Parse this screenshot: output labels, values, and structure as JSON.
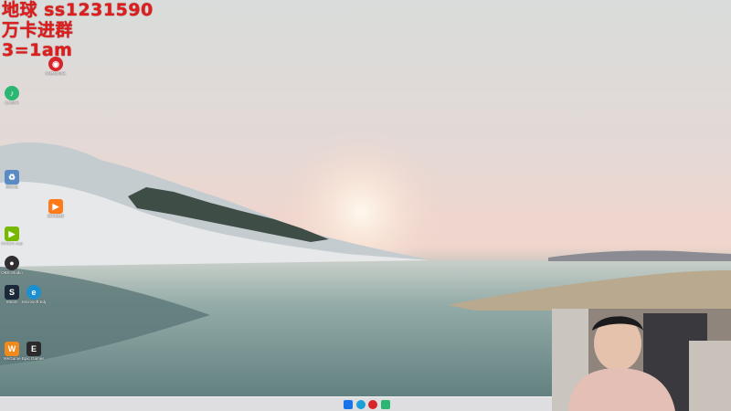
{
  "overlay": {
    "line1": "地球 ss1231590",
    "line2": "万卡进群",
    "line3": "3=1am"
  },
  "desktop_icons": [
    {
      "id": "recycle-bin",
      "label": "回收站",
      "color": "#5a8bc4",
      "glyph": "♻"
    },
    {
      "id": "qq-music",
      "label": "QQ音乐",
      "color": "#2bb673",
      "glyph": "♪"
    },
    {
      "id": "edge",
      "label": "Microsoft Edge",
      "color": "#1b8fd1",
      "glyph": "e"
    },
    {
      "id": "steam",
      "label": "Steam",
      "color": "#1b2838",
      "glyph": "S"
    },
    {
      "id": "obs",
      "label": "OBS Studio",
      "color": "#302e31",
      "glyph": "●"
    },
    {
      "id": "nvidia",
      "label": "NVIDIA App",
      "color": "#76b900",
      "glyph": "▶"
    },
    {
      "id": "wegame",
      "label": "WeGame",
      "color": "#f08a1c",
      "glyph": "W"
    },
    {
      "id": "epic",
      "label": "Epic Games Launcher",
      "color": "#2a2a2a",
      "glyph": "E"
    },
    {
      "id": "netease",
      "label": "网易云音乐",
      "color": "#d6252b",
      "glyph": "◉"
    },
    {
      "id": "tencent-video",
      "label": "腾讯视频",
      "color": "#ff7a1a",
      "glyph": "▶"
    }
  ],
  "taskbar": {
    "items": [
      {
        "name": "start-button",
        "color": "#1a73e8"
      },
      {
        "name": "edge-taskbar-icon",
        "color": "#1ba0d8"
      },
      {
        "name": "netease-taskbar-icon",
        "color": "#d6252b"
      },
      {
        "name": "wegame-taskbar-icon",
        "color": "#2bb673"
      },
      {
        "name": "terminal-taskbar-icon",
        "color": "#3a3a3a"
      }
    ]
  },
  "colors": {
    "overlay_text": "#e01d1d",
    "taskbar": "#ece8eb"
  }
}
